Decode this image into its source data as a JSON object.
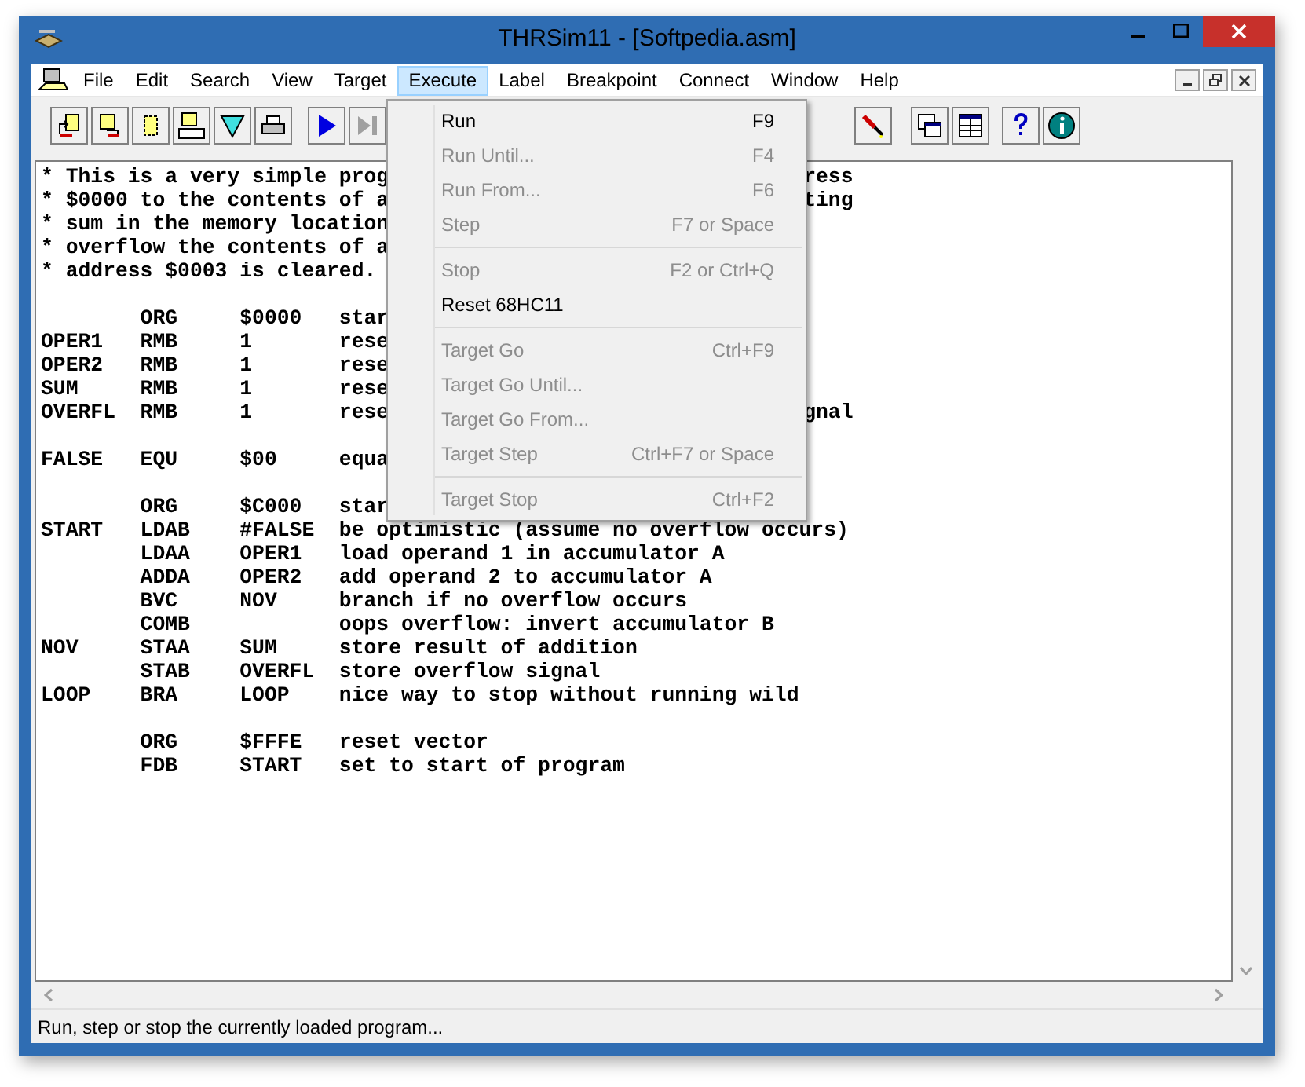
{
  "window": {
    "title": "THRSim11 - [Softpedia.asm]"
  },
  "menu_bar": [
    {
      "label": "File",
      "selected": false
    },
    {
      "label": "Edit",
      "selected": false
    },
    {
      "label": "Search",
      "selected": false
    },
    {
      "label": "View",
      "selected": false
    },
    {
      "label": "Target",
      "selected": false
    },
    {
      "label": "Execute",
      "selected": true
    },
    {
      "label": "Label",
      "selected": false
    },
    {
      "label": "Breakpoint",
      "selected": false
    },
    {
      "label": "Connect",
      "selected": false
    },
    {
      "label": "Window",
      "selected": false
    },
    {
      "label": "Help",
      "selected": false
    }
  ],
  "code_blocks": [
    [
      {
        "left": "* This is a very simple prog",
        "right": "ress"
      },
      {
        "left": "* $0000 to the contents of a",
        "right": "ting"
      },
      {
        "left": "* sum in the memory location"
      },
      {
        "left": "* overflow the contents of a"
      },
      {
        "left": "* address $0003 is cleared."
      }
    ],
    [
      {
        "left": "        ORG     $0000   star"
      },
      {
        "left": "OPER1   RMB     1       rese"
      },
      {
        "left": "OPER2   RMB     1       rese"
      },
      {
        "left": "SUM     RMB     1       rese"
      },
      {
        "left": "OVERFL  RMB     1       rese",
        "right": "gnal"
      }
    ],
    [
      {
        "left": "FALSE   EQU     $00     equa"
      }
    ],
    [
      {
        "left": "        ORG     $C000   star"
      },
      {
        "left": "START   LDAB    #FALSE  be optimistic (assume no overflow occurs)"
      },
      {
        "left": "        LDAA    OPER1   load operand 1 in accumulator A"
      },
      {
        "left": "        ADDA    OPER2   add operand 2 to accumulator A"
      },
      {
        "left": "        BVC     NOV     branch if no overflow occurs"
      },
      {
        "left": "        COMB            oops overflow: invert accumulator B"
      },
      {
        "left": "NOV     STAA    SUM     store result of addition"
      },
      {
        "left": "        STAB    OVERFL  store overflow signal"
      },
      {
        "left": "LOOP    BRA     LOOP    nice way to stop without running wild"
      }
    ],
    [
      {
        "left": "        ORG     $FFFE   reset vector"
      },
      {
        "left": "        FDB     START   set to start of program"
      }
    ]
  ],
  "execute_menu": [
    {
      "kind": "item",
      "label": "Run",
      "shortcut": "F9",
      "disabled": false
    },
    {
      "kind": "item",
      "label": "Run Until...",
      "shortcut": "F4",
      "disabled": true
    },
    {
      "kind": "item",
      "label": "Run From...",
      "shortcut": "F6",
      "disabled": true
    },
    {
      "kind": "item",
      "label": "Step",
      "shortcut": "F7 or Space",
      "disabled": true
    },
    {
      "kind": "separator"
    },
    {
      "kind": "item",
      "label": "Stop",
      "shortcut": "F2 or Ctrl+Q",
      "disabled": true
    },
    {
      "kind": "item",
      "label": "Reset 68HC11",
      "disabled": false
    },
    {
      "kind": "separator"
    },
    {
      "kind": "item",
      "label": "Target Go",
      "shortcut": "Ctrl+F9",
      "disabled": true
    },
    {
      "kind": "item",
      "label": "Target Go Until...",
      "disabled": true
    },
    {
      "kind": "item",
      "label": "Target Go From...",
      "disabled": true
    },
    {
      "kind": "item",
      "label": "Target Step",
      "shortcut": "Ctrl+F7 or Space",
      "disabled": true
    },
    {
      "kind": "separator"
    },
    {
      "kind": "item",
      "label": "Target Stop",
      "shortcut": "Ctrl+F2",
      "disabled": true
    }
  ],
  "status_bar": "Run, step or stop the currently loaded program..."
}
